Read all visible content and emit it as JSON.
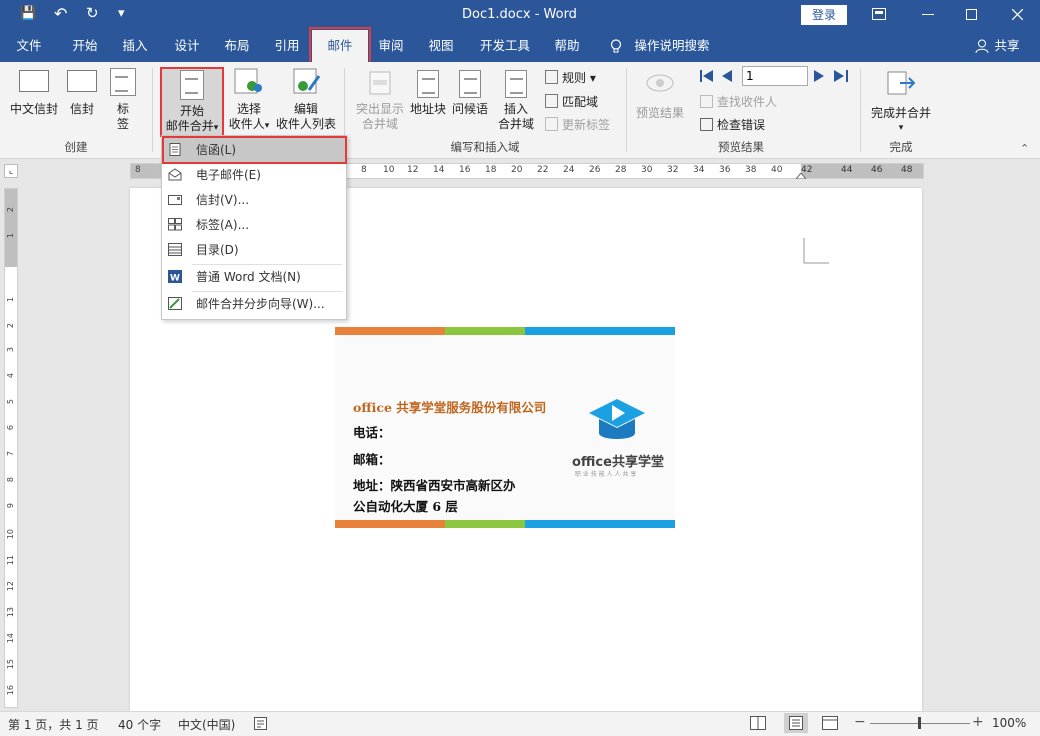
{
  "titlebar": {
    "title": "Doc1.docx  -  Word",
    "login": "登录",
    "save_glyph": "💾",
    "undo_glyph": "↶",
    "redo_glyph": "↻",
    "qat_glyph": "▾"
  },
  "tabs": [
    {
      "label": "文件"
    },
    {
      "label": "开始"
    },
    {
      "label": "插入"
    },
    {
      "label": "设计"
    },
    {
      "label": "布局"
    },
    {
      "label": "引用"
    },
    {
      "label": "邮件"
    },
    {
      "label": "审阅"
    },
    {
      "label": "视图"
    },
    {
      "label": "开发工具"
    },
    {
      "label": "帮助"
    }
  ],
  "tell_me": "操作说明搜索",
  "share": "共享",
  "ribbon": {
    "create": {
      "label": "创建",
      "chinese_envelope": "中文信封",
      "envelope": "信封",
      "labels_l1": "标",
      "labels_l2": "签"
    },
    "start": {
      "l1": "开始",
      "l2": "邮件合并",
      "arrow": "▾"
    },
    "select": {
      "l1": "选择",
      "l2": "收件人",
      "arrow": "▾"
    },
    "edit": {
      "l1": "编辑",
      "l2": "收件人列表"
    },
    "write": {
      "label": "编写和插入域",
      "highlight_l1": "突出显示",
      "highlight_l2": "合并域",
      "address": "地址块",
      "greeting": "问候语",
      "insert_l1": "插入",
      "insert_l2": "合并域",
      "rules": "规则",
      "match": "匹配域",
      "update": "更新标签"
    },
    "preview": {
      "label": "预览结果",
      "button": "预览结果",
      "record": "1",
      "find": "查找收件人",
      "check": "检查错误"
    },
    "finish": {
      "label": "完成",
      "button": "完成并合并"
    }
  },
  "dropdown": [
    {
      "label": "信函(L)"
    },
    {
      "label": "电子邮件(E)"
    },
    {
      "label": "信封(V)..."
    },
    {
      "label": "标签(A)..."
    },
    {
      "label": "目录(D)"
    },
    {
      "label": "普通 Word 文档(N)"
    },
    {
      "label": "邮件合并分步向导(W)..."
    }
  ],
  "ruler": {
    "numbers": [
      "8",
      "6",
      "4",
      "2",
      "2",
      "4",
      "6",
      "8",
      "10",
      "12",
      "14",
      "16",
      "18",
      "20",
      "22",
      "24",
      "26",
      "28",
      "30",
      "32",
      "34",
      "36",
      "38",
      "40",
      "42",
      "44",
      "46",
      "48"
    ]
  },
  "vruler": {
    "numbers": [
      "2",
      "1",
      "1",
      "2",
      "3",
      "4",
      "5",
      "6",
      "7",
      "8",
      "9",
      "10",
      "11",
      "12",
      "13",
      "14",
      "15",
      "16",
      "17",
      "18",
      "19",
      "20"
    ]
  },
  "card": {
    "company": "office 共享学堂服务股份有限公司",
    "phone": "电话：",
    "email": "邮箱：",
    "address_l1": "地址：陕西省西安市高新区办",
    "address_l2": "公自动化大厦 6 层",
    "logo": "office共享学堂",
    "logo_sub": "职 业 技 能 人 人 共 享",
    "colors": {
      "orange": "#e8823a",
      "green": "#8cc63f",
      "blue": "#1ba1e2",
      "company": "#c0661f"
    }
  },
  "status": {
    "page": "第 1 页，共 1 页",
    "words": "40 个字",
    "lang": "中文(中国)",
    "zoom": "100%"
  },
  "colors": {
    "brand": "#2b579a",
    "highlight_red": "#e03a3a"
  }
}
